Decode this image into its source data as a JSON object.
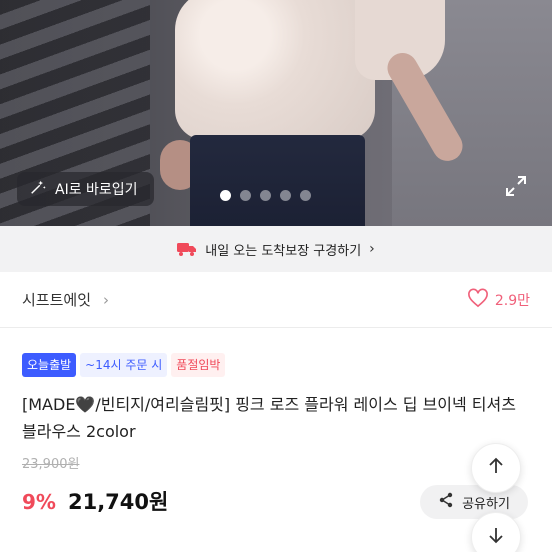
{
  "hero": {
    "ai_button_label": "AI로 바로입기",
    "slide_count": 5,
    "active_slide": 1
  },
  "delivery": {
    "label": "내일 오는 도착보장 구경하기",
    "icon": "truck-icon",
    "accent": "#f04a5a"
  },
  "shop": {
    "name": "시프트에잇",
    "like_count": "2.9만",
    "like_color": "#f0607a"
  },
  "badges": {
    "today": "오늘출발",
    "deadline": "~14시 주문 시",
    "soldout": "품절임박"
  },
  "product": {
    "title": "[MADE🖤/빈티지/여리슬림핏] 핑크 로즈 플라워 레이스 딥 브이넥 티셔츠 블라우스 2color",
    "original_price": "23,900원",
    "discount": "9%",
    "price": "21,740원"
  },
  "actions": {
    "share_label": "공유하기"
  }
}
